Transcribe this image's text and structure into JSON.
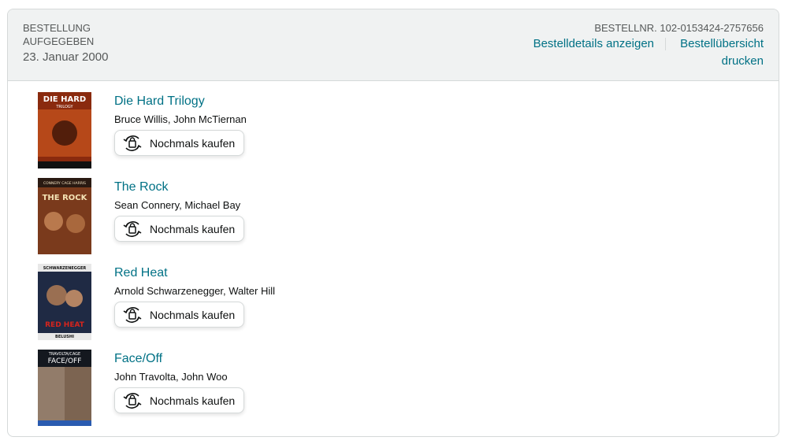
{
  "order": {
    "placed_label": "BESTELLUNG AUFGEGEBEN",
    "placed_date": "23. Januar 2000",
    "number_label": "BESTELLNR.",
    "number": "102-0153424-2757656",
    "details_link": "Bestelldetails anzeigen",
    "print_link": "Bestellübersicht drucken"
  },
  "items": [
    {
      "title": "Die Hard Trilogy",
      "authors": "Bruce Willis, John McTiernan",
      "buy_again": "Nochmals kaufen",
      "cover_text": "DIE HARD",
      "cover_sub": "TRILOGY",
      "cover_bg": "#8a2a0e"
    },
    {
      "title": "The Rock",
      "authors": "Sean Connery, Michael Bay",
      "buy_again": "Nochmals kaufen",
      "cover_text": "THE ROCK",
      "cover_sub": "CONNERY CAGE HARRIS",
      "cover_bg": "#7a3a1c"
    },
    {
      "title": "Red Heat",
      "authors": "Arnold Schwarzenegger, Walter Hill",
      "buy_again": "Nochmals kaufen",
      "cover_text": "RED HEAT",
      "cover_sub": "SCHWARZENEGGER",
      "cover_top": "BELUSHI",
      "cover_bg": "#1f2a44"
    },
    {
      "title": "Face/Off",
      "authors": "John Travolta, John Woo",
      "buy_again": "Nochmals kaufen",
      "cover_text": "FACE/OFF",
      "cover_sub": "TRAVOLTA/CAGE",
      "cover_bg": "#14181f"
    }
  ],
  "colors": {
    "link": "#007185",
    "header_bg": "#f0f2f2",
    "border": "#d5d9d9"
  },
  "icons": {
    "buy_again": "buy-again-icon"
  }
}
